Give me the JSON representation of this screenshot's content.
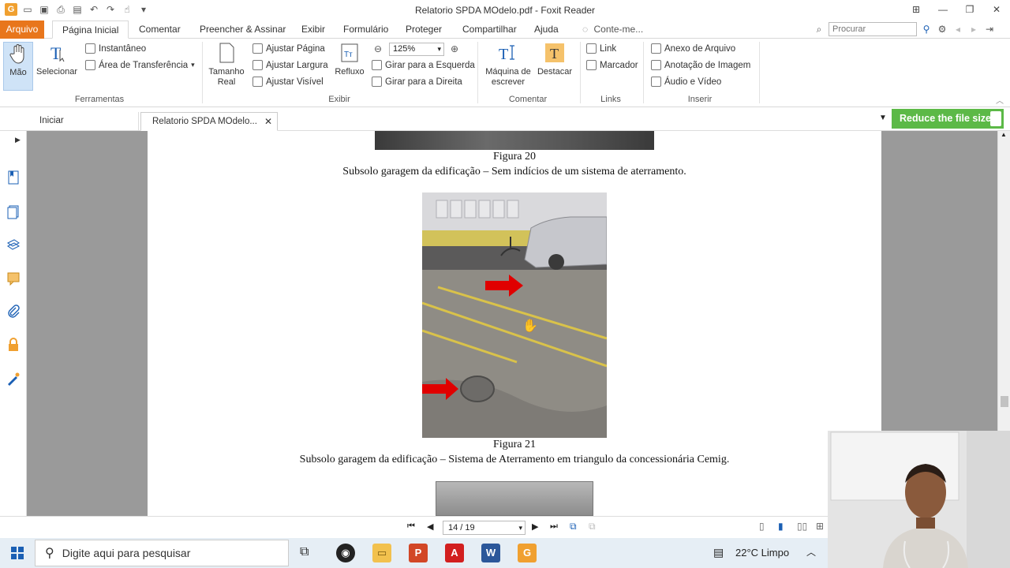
{
  "window": {
    "title": "Relatorio SPDA MOdelo.pdf - Foxit Reader"
  },
  "ribbon_tabs": [
    "Arquivo",
    "Página Inicial",
    "Comentar",
    "Preencher & Assinar",
    "Exibir",
    "Formulário",
    "Proteger",
    "Compartilhar",
    "Ajuda",
    "Conte-me..."
  ],
  "search": {
    "placeholder": "Procurar"
  },
  "ribbon": {
    "ferramentas": {
      "label": "Ferramentas",
      "mao": "Mão",
      "selecionar": "Selecionar",
      "instantaneo": "Instantâneo",
      "area": "Área de Transferência"
    },
    "exibir": {
      "label": "Exibir",
      "tamanho_real_1": "Tamanho",
      "tamanho_real_2": "Real",
      "ajustar_pagina": "Ajustar Página",
      "ajustar_largura": "Ajustar Largura",
      "ajustar_visivel": "Ajustar Visível",
      "refluxo": "Refluxo",
      "zoom": "125%",
      "girar_esquerda": "Girar para a Esquerda",
      "girar_direita": "Girar para a Direita"
    },
    "comentar": {
      "label": "Comentar",
      "maquina_1": "Máquina de",
      "maquina_2": "escrever",
      "destacar": "Destacar"
    },
    "links": {
      "label": "Links",
      "link": "Link",
      "marcador": "Marcador"
    },
    "inserir": {
      "label": "Inserir",
      "anexo": "Anexo de Arquivo",
      "anotacao": "Anotação de Imagem",
      "audio": "Áudio e Vídeo"
    }
  },
  "doc_tabs": {
    "home": "Iniciar",
    "doc": "Relatorio SPDA MOdelo..."
  },
  "promo": {
    "reduce": "Reduce the file size"
  },
  "document": {
    "fig20_label": "Figura 20",
    "fig20_caption": "Subsolo garagem da edificação – Sem indícios de um sistema de aterramento.",
    "fig21_label": "Figura 21",
    "fig21_caption": "Subsolo garagem da edificação – Sistema de Aterramento em triangulo da concessionária Cemig."
  },
  "navigation": {
    "page": "14 / 19"
  },
  "taskbar": {
    "search_placeholder": "Digite aqui para pesquisar",
    "weather": "22°C  Limpo"
  },
  "colors": {
    "file_tab": "#e8761c",
    "promo": "#5cb947",
    "arrow": "#e00000",
    "doc_bg": "#9a9a9a"
  }
}
